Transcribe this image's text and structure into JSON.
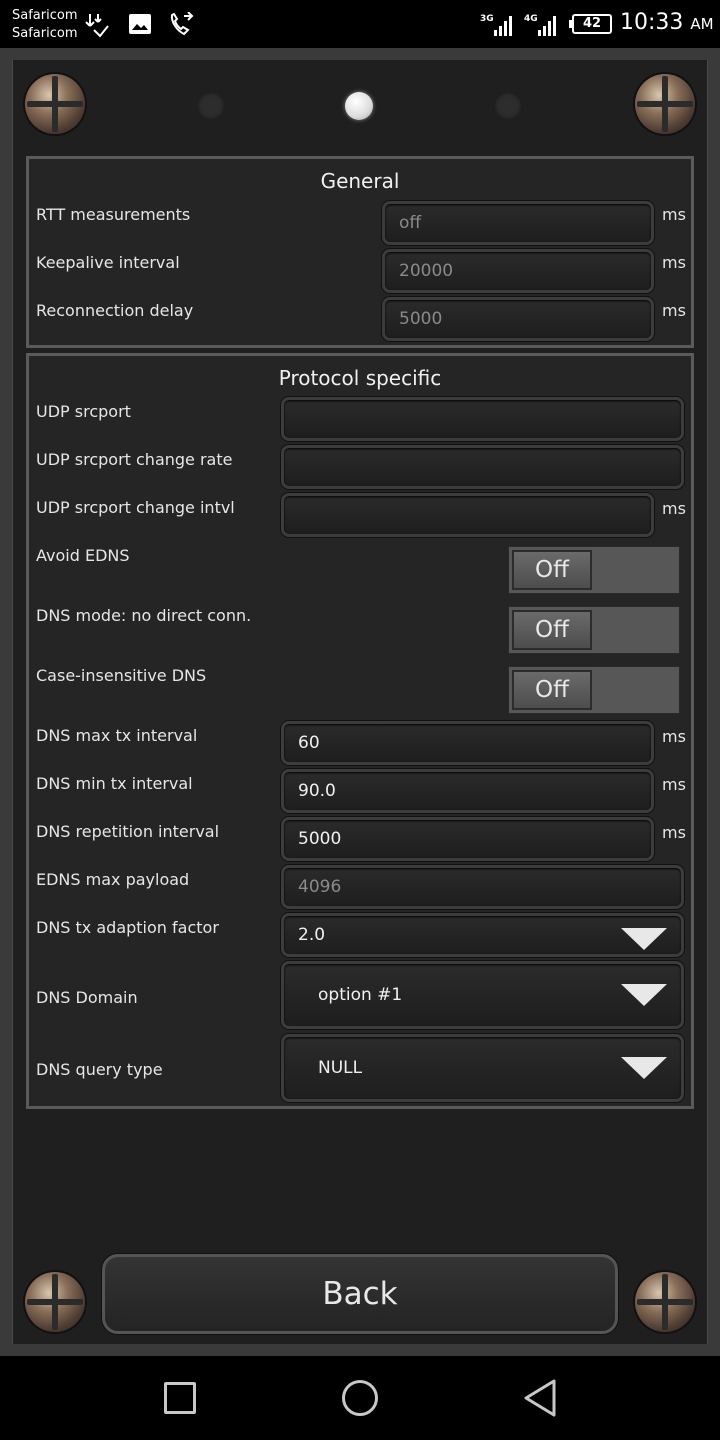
{
  "status_bar": {
    "carrier_1": "Safaricom",
    "carrier_2": "Safaricom",
    "network_1": "3G",
    "network_2": "4G",
    "battery": "42",
    "time": "10:33",
    "ampm": "AM",
    "icons": [
      "download-icon",
      "image-icon",
      "call-forwarding-icon",
      "signal-icon",
      "signal-icon",
      "battery-icon"
    ]
  },
  "pager": {
    "pages": 3,
    "active": 1
  },
  "general": {
    "title": "General",
    "rows": [
      {
        "label": "RTT measurements",
        "value": "off",
        "unit": "ms"
      },
      {
        "label": "Keepalive interval",
        "value": "20000",
        "unit": "ms"
      },
      {
        "label": "Reconnection delay",
        "value": "5000",
        "unit": "ms"
      }
    ]
  },
  "protocol": {
    "title": "Protocol specific",
    "udp_srcport": {
      "label": "UDP srcport",
      "value": ""
    },
    "udp_change_rate": {
      "label": "UDP srcport change rate",
      "value": ""
    },
    "udp_change_intvl": {
      "label": "UDP srcport change intvl",
      "value": "",
      "unit": "ms"
    },
    "avoid_edns": {
      "label": "Avoid EDNS",
      "state": "Off"
    },
    "dns_no_direct": {
      "label": "DNS mode: no direct conn.",
      "state": "Off"
    },
    "case_insensitive": {
      "label": "Case-insensitive DNS",
      "state": "Off"
    },
    "dns_max_tx": {
      "label": "DNS max tx interval",
      "value": "60",
      "unit": "ms"
    },
    "dns_min_tx": {
      "label": "DNS min tx interval",
      "value": "90.0",
      "unit": "ms"
    },
    "dns_repetition": {
      "label": "DNS repetition interval",
      "value": "5000",
      "unit": "ms"
    },
    "edns_max_payload": {
      "label": "EDNS max payload",
      "placeholder": "4096"
    },
    "dns_tx_factor": {
      "label": "DNS tx adaption factor",
      "value": "2.0"
    },
    "dns_domain": {
      "label": "DNS Domain",
      "value": "option #1"
    },
    "dns_query_type": {
      "label": "DNS query type",
      "value": "NULL"
    }
  },
  "back_label": "Back"
}
